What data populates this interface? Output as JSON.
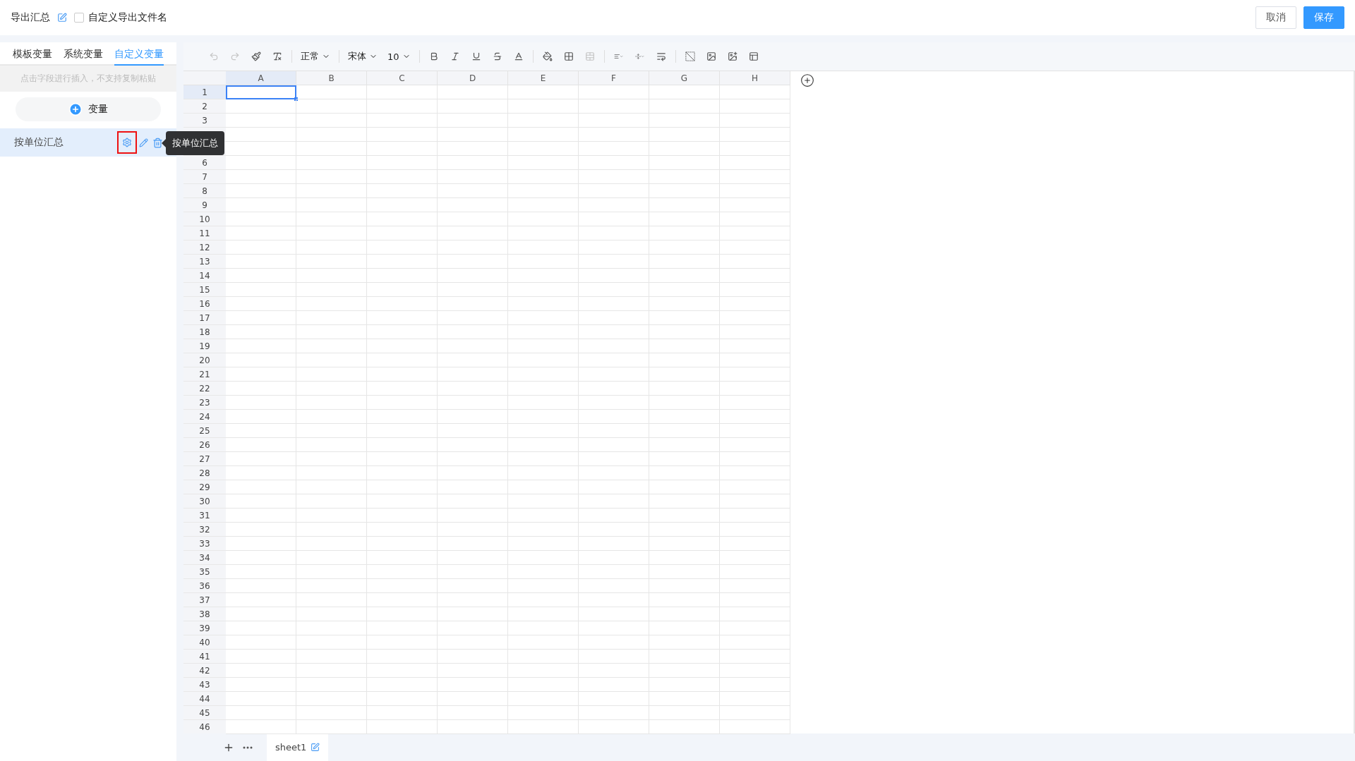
{
  "header": {
    "title": "导出汇总",
    "custom_filename": {
      "label": "自定义导出文件名",
      "checked": false
    },
    "buttons": [
      {
        "label": "取消",
        "kind": "secondary"
      },
      {
        "label": "保存",
        "kind": "primary"
      }
    ]
  },
  "sidebar": {
    "tabs": [
      {
        "label": "模板变量",
        "selected": false
      },
      {
        "label": "系统变量",
        "selected": false
      },
      {
        "label": "自定义变量",
        "selected": true
      }
    ],
    "hint": "点击字段进行插入，不支持复制粘贴",
    "add_button": "变量",
    "variables": [
      {
        "name": "按单位汇总",
        "selected": true,
        "settings_highlighted": true
      }
    ],
    "tooltip": "按单位汇总"
  },
  "toolbar": [
    {
      "kind": "undo",
      "disabled": true
    },
    {
      "kind": "redo",
      "disabled": true
    },
    {
      "kind": "painter",
      "disabled": false
    },
    {
      "kind": "clear",
      "disabled": false
    },
    {
      "kind": "separator"
    },
    {
      "kind": "dropdown",
      "value": "正常"
    },
    {
      "kind": "separator"
    },
    {
      "kind": "dropdown",
      "value": "宋体"
    },
    {
      "kind": "dropdown",
      "value": "10"
    },
    {
      "kind": "separator"
    },
    {
      "kind": "bold",
      "disabled": false
    },
    {
      "kind": "italic",
      "disabled": false
    },
    {
      "kind": "underline",
      "disabled": false
    },
    {
      "kind": "strike",
      "disabled": false
    },
    {
      "kind": "font-color",
      "disabled": false
    },
    {
      "kind": "separator"
    },
    {
      "kind": "fill",
      "disabled": false
    },
    {
      "kind": "borders",
      "disabled": false
    },
    {
      "kind": "merge",
      "disabled": true
    },
    {
      "kind": "separator"
    },
    {
      "kind": "align",
      "disabled": false
    },
    {
      "kind": "valign",
      "disabled": false
    },
    {
      "kind": "wrap",
      "disabled": false
    },
    {
      "kind": "separator"
    },
    {
      "kind": "diagonal",
      "disabled": false
    },
    {
      "kind": "image-float",
      "disabled": false
    },
    {
      "kind": "image-cell",
      "disabled": false
    },
    {
      "kind": "freeze",
      "disabled": false
    }
  ],
  "sheet": {
    "columns": [
      {
        "label": "A",
        "selected": true
      },
      {
        "label": "B",
        "selected": false
      },
      {
        "label": "C",
        "selected": false
      },
      {
        "label": "D",
        "selected": false
      },
      {
        "label": "E",
        "selected": false
      },
      {
        "label": "F",
        "selected": false
      },
      {
        "label": "G",
        "selected": false
      },
      {
        "label": "H",
        "selected": false
      }
    ],
    "rows": [
      {
        "label": "1",
        "selected": true
      },
      {
        "label": "2",
        "selected": false
      },
      {
        "label": "3",
        "selected": false
      },
      {
        "selected": false
      },
      {
        "selected": false
      },
      {
        "label": "6",
        "selected": false
      },
      {
        "label": "7",
        "selected": false
      },
      {
        "label": "8",
        "selected": false
      },
      {
        "label": "9",
        "selected": false
      },
      {
        "label": "10",
        "selected": false
      },
      {
        "label": "11",
        "selected": false
      },
      {
        "label": "12",
        "selected": false
      },
      {
        "label": "13",
        "selected": false
      },
      {
        "label": "14",
        "selected": false
      },
      {
        "label": "15",
        "selected": false
      },
      {
        "label": "16",
        "selected": false
      },
      {
        "label": "17",
        "selected": false
      },
      {
        "label": "18",
        "selected": false
      },
      {
        "label": "19",
        "selected": false
      },
      {
        "label": "20",
        "selected": false
      },
      {
        "label": "21",
        "selected": false
      },
      {
        "label": "22",
        "selected": false
      },
      {
        "label": "23",
        "selected": false
      },
      {
        "label": "24",
        "selected": false
      },
      {
        "label": "25",
        "selected": false
      },
      {
        "label": "26",
        "selected": false
      },
      {
        "label": "27",
        "selected": false
      },
      {
        "label": "28",
        "selected": false
      },
      {
        "label": "29",
        "selected": false
      },
      {
        "label": "30",
        "selected": false
      },
      {
        "label": "31",
        "selected": false
      },
      {
        "label": "32",
        "selected": false
      },
      {
        "label": "33",
        "selected": false
      },
      {
        "label": "34",
        "selected": false
      },
      {
        "label": "35",
        "selected": false
      },
      {
        "label": "36",
        "selected": false
      },
      {
        "label": "37",
        "selected": false
      },
      {
        "label": "38",
        "selected": false
      },
      {
        "label": "39",
        "selected": false
      },
      {
        "label": "40",
        "selected": false
      },
      {
        "label": "41",
        "selected": false
      },
      {
        "label": "42",
        "selected": false
      },
      {
        "label": "43",
        "selected": false
      },
      {
        "label": "44",
        "selected": false
      },
      {
        "label": "45",
        "selected": false
      },
      {
        "label": "46",
        "selected": false
      }
    ],
    "tabs": [
      {
        "name": "sheet1",
        "selected": true
      }
    ]
  }
}
